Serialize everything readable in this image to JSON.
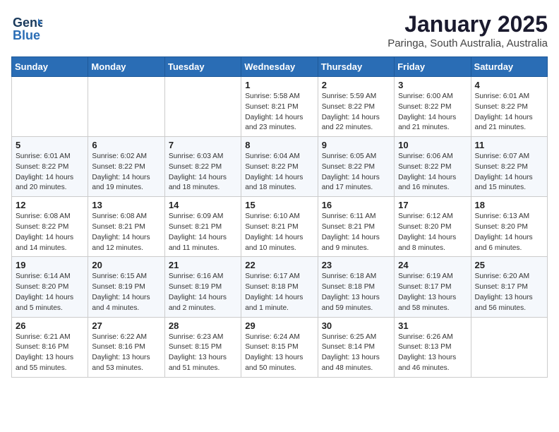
{
  "header": {
    "logo_general": "General",
    "logo_blue": "Blue",
    "month": "January 2025",
    "location": "Paringa, South Australia, Australia"
  },
  "weekdays": [
    "Sunday",
    "Monday",
    "Tuesday",
    "Wednesday",
    "Thursday",
    "Friday",
    "Saturday"
  ],
  "weeks": [
    [
      {
        "day": "",
        "sunrise": "",
        "sunset": "",
        "daylight": ""
      },
      {
        "day": "",
        "sunrise": "",
        "sunset": "",
        "daylight": ""
      },
      {
        "day": "",
        "sunrise": "",
        "sunset": "",
        "daylight": ""
      },
      {
        "day": "1",
        "sunrise": "Sunrise: 5:58 AM",
        "sunset": "Sunset: 8:21 PM",
        "daylight": "Daylight: 14 hours and 23 minutes."
      },
      {
        "day": "2",
        "sunrise": "Sunrise: 5:59 AM",
        "sunset": "Sunset: 8:22 PM",
        "daylight": "Daylight: 14 hours and 22 minutes."
      },
      {
        "day": "3",
        "sunrise": "Sunrise: 6:00 AM",
        "sunset": "Sunset: 8:22 PM",
        "daylight": "Daylight: 14 hours and 21 minutes."
      },
      {
        "day": "4",
        "sunrise": "Sunrise: 6:01 AM",
        "sunset": "Sunset: 8:22 PM",
        "daylight": "Daylight: 14 hours and 21 minutes."
      }
    ],
    [
      {
        "day": "5",
        "sunrise": "Sunrise: 6:01 AM",
        "sunset": "Sunset: 8:22 PM",
        "daylight": "Daylight: 14 hours and 20 minutes."
      },
      {
        "day": "6",
        "sunrise": "Sunrise: 6:02 AM",
        "sunset": "Sunset: 8:22 PM",
        "daylight": "Daylight: 14 hours and 19 minutes."
      },
      {
        "day": "7",
        "sunrise": "Sunrise: 6:03 AM",
        "sunset": "Sunset: 8:22 PM",
        "daylight": "Daylight: 14 hours and 18 minutes."
      },
      {
        "day": "8",
        "sunrise": "Sunrise: 6:04 AM",
        "sunset": "Sunset: 8:22 PM",
        "daylight": "Daylight: 14 hours and 18 minutes."
      },
      {
        "day": "9",
        "sunrise": "Sunrise: 6:05 AM",
        "sunset": "Sunset: 8:22 PM",
        "daylight": "Daylight: 14 hours and 17 minutes."
      },
      {
        "day": "10",
        "sunrise": "Sunrise: 6:06 AM",
        "sunset": "Sunset: 8:22 PM",
        "daylight": "Daylight: 14 hours and 16 minutes."
      },
      {
        "day": "11",
        "sunrise": "Sunrise: 6:07 AM",
        "sunset": "Sunset: 8:22 PM",
        "daylight": "Daylight: 14 hours and 15 minutes."
      }
    ],
    [
      {
        "day": "12",
        "sunrise": "Sunrise: 6:08 AM",
        "sunset": "Sunset: 8:22 PM",
        "daylight": "Daylight: 14 hours and 14 minutes."
      },
      {
        "day": "13",
        "sunrise": "Sunrise: 6:08 AM",
        "sunset": "Sunset: 8:21 PM",
        "daylight": "Daylight: 14 hours and 12 minutes."
      },
      {
        "day": "14",
        "sunrise": "Sunrise: 6:09 AM",
        "sunset": "Sunset: 8:21 PM",
        "daylight": "Daylight: 14 hours and 11 minutes."
      },
      {
        "day": "15",
        "sunrise": "Sunrise: 6:10 AM",
        "sunset": "Sunset: 8:21 PM",
        "daylight": "Daylight: 14 hours and 10 minutes."
      },
      {
        "day": "16",
        "sunrise": "Sunrise: 6:11 AM",
        "sunset": "Sunset: 8:21 PM",
        "daylight": "Daylight: 14 hours and 9 minutes."
      },
      {
        "day": "17",
        "sunrise": "Sunrise: 6:12 AM",
        "sunset": "Sunset: 8:20 PM",
        "daylight": "Daylight: 14 hours and 8 minutes."
      },
      {
        "day": "18",
        "sunrise": "Sunrise: 6:13 AM",
        "sunset": "Sunset: 8:20 PM",
        "daylight": "Daylight: 14 hours and 6 minutes."
      }
    ],
    [
      {
        "day": "19",
        "sunrise": "Sunrise: 6:14 AM",
        "sunset": "Sunset: 8:20 PM",
        "daylight": "Daylight: 14 hours and 5 minutes."
      },
      {
        "day": "20",
        "sunrise": "Sunrise: 6:15 AM",
        "sunset": "Sunset: 8:19 PM",
        "daylight": "Daylight: 14 hours and 4 minutes."
      },
      {
        "day": "21",
        "sunrise": "Sunrise: 6:16 AM",
        "sunset": "Sunset: 8:19 PM",
        "daylight": "Daylight: 14 hours and 2 minutes."
      },
      {
        "day": "22",
        "sunrise": "Sunrise: 6:17 AM",
        "sunset": "Sunset: 8:18 PM",
        "daylight": "Daylight: 14 hours and 1 minute."
      },
      {
        "day": "23",
        "sunrise": "Sunrise: 6:18 AM",
        "sunset": "Sunset: 8:18 PM",
        "daylight": "Daylight: 13 hours and 59 minutes."
      },
      {
        "day": "24",
        "sunrise": "Sunrise: 6:19 AM",
        "sunset": "Sunset: 8:17 PM",
        "daylight": "Daylight: 13 hours and 58 minutes."
      },
      {
        "day": "25",
        "sunrise": "Sunrise: 6:20 AM",
        "sunset": "Sunset: 8:17 PM",
        "daylight": "Daylight: 13 hours and 56 minutes."
      }
    ],
    [
      {
        "day": "26",
        "sunrise": "Sunrise: 6:21 AM",
        "sunset": "Sunset: 8:16 PM",
        "daylight": "Daylight: 13 hours and 55 minutes."
      },
      {
        "day": "27",
        "sunrise": "Sunrise: 6:22 AM",
        "sunset": "Sunset: 8:16 PM",
        "daylight": "Daylight: 13 hours and 53 minutes."
      },
      {
        "day": "28",
        "sunrise": "Sunrise: 6:23 AM",
        "sunset": "Sunset: 8:15 PM",
        "daylight": "Daylight: 13 hours and 51 minutes."
      },
      {
        "day": "29",
        "sunrise": "Sunrise: 6:24 AM",
        "sunset": "Sunset: 8:15 PM",
        "daylight": "Daylight: 13 hours and 50 minutes."
      },
      {
        "day": "30",
        "sunrise": "Sunrise: 6:25 AM",
        "sunset": "Sunset: 8:14 PM",
        "daylight": "Daylight: 13 hours and 48 minutes."
      },
      {
        "day": "31",
        "sunrise": "Sunrise: 6:26 AM",
        "sunset": "Sunset: 8:13 PM",
        "daylight": "Daylight: 13 hours and 46 minutes."
      },
      {
        "day": "",
        "sunrise": "",
        "sunset": "",
        "daylight": ""
      }
    ]
  ]
}
